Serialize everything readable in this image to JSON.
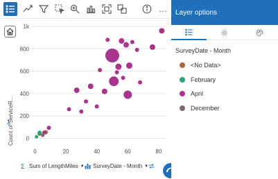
{
  "toolbar": {
    "items": [
      {
        "icon": "list-icon",
        "active": true
      },
      {
        "icon": "trend-icon"
      },
      {
        "icon": "filter-icon"
      },
      {
        "icon": "select-icon"
      },
      {
        "icon": "zoom-icon"
      },
      {
        "icon": "bar-chart-icon"
      },
      {
        "icon": "expand-icon"
      },
      {
        "icon": "copy-icon"
      },
      {
        "icon": "info-icon"
      },
      {
        "icon": "more-icon"
      }
    ],
    "more_label": "…"
  },
  "chart": {
    "y_label": "Count of ServiceR...",
    "x_field": "Sum of LengthMiles",
    "color_field": "SurveyDate - Month"
  },
  "chart_data": {
    "type": "scatter",
    "xlim": [
      -2,
      85
    ],
    "ylim": [
      -40,
      1000
    ],
    "x_ticks": [
      "0",
      "20",
      "40",
      "60",
      "80"
    ],
    "x_tick_values": [
      0,
      20,
      40,
      60,
      80
    ],
    "y_ticks": [
      "0",
      "200",
      "400",
      "600",
      "800",
      "1k"
    ],
    "y_tick_values": [
      0,
      200,
      400,
      600,
      800,
      1000
    ],
    "series": [
      {
        "name": "<No Data>",
        "color": "#a9663c",
        "points": [
          [
            3,
            42,
            3
          ],
          [
            7,
            55,
            3
          ]
        ]
      },
      {
        "name": "February",
        "color": "#2ea07a",
        "points": [
          [
            1,
            15,
            2.5
          ],
          [
            3,
            52,
            3
          ]
        ]
      },
      {
        "name": "April",
        "color": "#a8348f",
        "points": [
          [
            6,
            52,
            3
          ],
          [
            9,
            95,
            3
          ],
          [
            22,
            260,
            3
          ],
          [
            27,
            430,
            4
          ],
          [
            33,
            330,
            3
          ],
          [
            36,
            465,
            4
          ],
          [
            30,
            240,
            3
          ],
          [
            40,
            285,
            3
          ],
          [
            42,
            610,
            3
          ],
          [
            45,
            420,
            4
          ],
          [
            50,
            740,
            10
          ],
          [
            51,
            510,
            7
          ],
          [
            54,
            640,
            4.5
          ],
          [
            56,
            870,
            4
          ],
          [
            57,
            540,
            3
          ],
          [
            59,
            835,
            4
          ],
          [
            61,
            650,
            4.5
          ],
          [
            60,
            390,
            6
          ],
          [
            63,
            860,
            3
          ],
          [
            66,
            790,
            3
          ],
          [
            68,
            500,
            3
          ],
          [
            76,
            815,
            4
          ],
          [
            82,
            960,
            4
          ],
          [
            47,
            880,
            3
          ],
          [
            53,
            590,
            3
          ]
        ]
      },
      {
        "name": "December",
        "color": "#7d6b6b",
        "points": [
          [
            5,
            28,
            2.5
          ]
        ]
      }
    ],
    "grid": true
  },
  "panel": {
    "title": "Layer options",
    "tabs": [
      {
        "icon": "legend-list-icon",
        "active": true
      },
      {
        "icon": "gear-icon"
      },
      {
        "icon": "palette-icon"
      }
    ],
    "legend_title": "SurveyDate - Month",
    "legend": [
      {
        "label": "<No Data>",
        "color": "#a9663c"
      },
      {
        "label": "February",
        "color": "#2ea07a"
      },
      {
        "label": "April",
        "color": "#a8348f"
      },
      {
        "label": "December",
        "color": "#7d6b6b"
      }
    ]
  }
}
